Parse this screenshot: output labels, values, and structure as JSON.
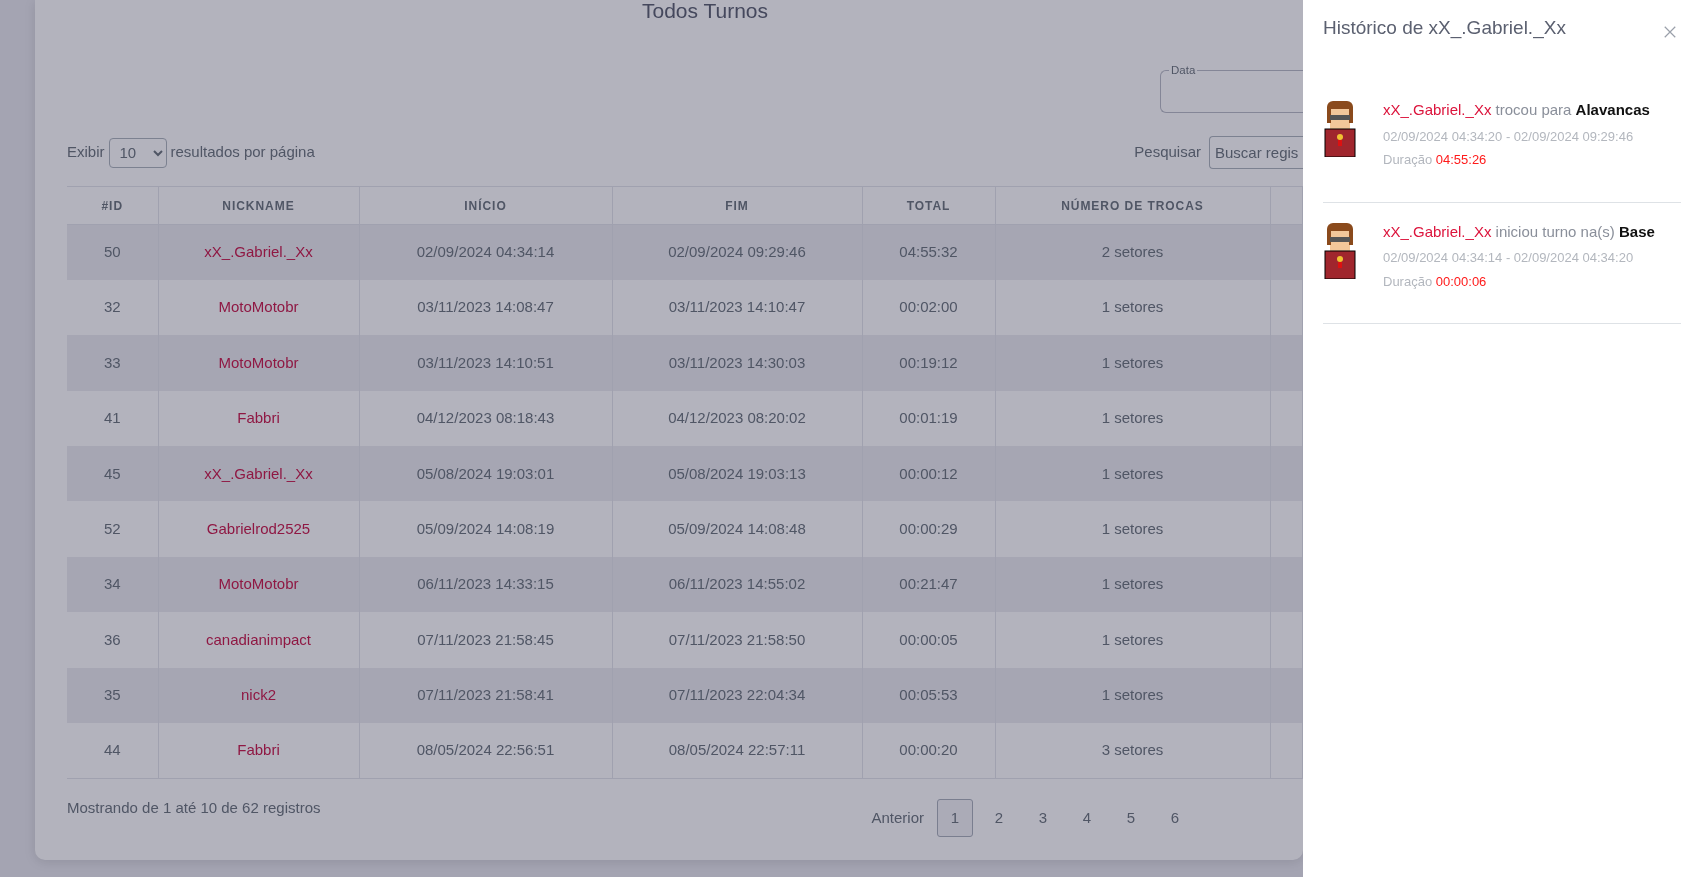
{
  "page": {
    "title": "Todos Turnos"
  },
  "date_filter": {
    "label": "Data"
  },
  "length": {
    "prefix": "Exibir",
    "value": "10",
    "suffix": "resultados por página"
  },
  "search": {
    "label": "Pesquisar",
    "placeholder": "Buscar regis"
  },
  "table": {
    "columns": [
      "#ID",
      "NICKNAME",
      "INÍCIO",
      "FIM",
      "TOTAL",
      "NÚMERO DE TROCAS"
    ],
    "rows": [
      {
        "id": "50",
        "nickname": "xX_.Gabriel._Xx",
        "start": "02/09/2024 04:34:14",
        "end": "02/09/2024 09:29:46",
        "total": "04:55:32",
        "trades": "2 setores"
      },
      {
        "id": "32",
        "nickname": "MotoMotobr",
        "start": "03/11/2023 14:08:47",
        "end": "03/11/2023 14:10:47",
        "total": "00:02:00",
        "trades": "1 setores"
      },
      {
        "id": "33",
        "nickname": "MotoMotobr",
        "start": "03/11/2023 14:10:51",
        "end": "03/11/2023 14:30:03",
        "total": "00:19:12",
        "trades": "1 setores"
      },
      {
        "id": "41",
        "nickname": "Fabbri",
        "start": "04/12/2023 08:18:43",
        "end": "04/12/2023 08:20:02",
        "total": "00:01:19",
        "trades": "1 setores"
      },
      {
        "id": "45",
        "nickname": "xX_.Gabriel._Xx",
        "start": "05/08/2024 19:03:01",
        "end": "05/08/2024 19:03:13",
        "total": "00:00:12",
        "trades": "1 setores"
      },
      {
        "id": "52",
        "nickname": "Gabrielrod2525",
        "start": "05/09/2024 14:08:19",
        "end": "05/09/2024 14:08:48",
        "total": "00:00:29",
        "trades": "1 setores"
      },
      {
        "id": "34",
        "nickname": "MotoMotobr",
        "start": "06/11/2023 14:33:15",
        "end": "06/11/2023 14:55:02",
        "total": "00:21:47",
        "trades": "1 setores"
      },
      {
        "id": "36",
        "nickname": "canadianimpact",
        "start": "07/11/2023 21:58:45",
        "end": "07/11/2023 21:58:50",
        "total": "00:00:05",
        "trades": "1 setores"
      },
      {
        "id": "35",
        "nickname": "nick2",
        "start": "07/11/2023 21:58:41",
        "end": "07/11/2023 22:04:34",
        "total": "00:05:53",
        "trades": "1 setores"
      },
      {
        "id": "44",
        "nickname": "Fabbri",
        "start": "08/05/2024 22:56:51",
        "end": "08/05/2024 22:57:11",
        "total": "00:00:20",
        "trades": "3 setores"
      }
    ]
  },
  "footer": {
    "info": "Mostrando de 1 até 10 de 62 registros"
  },
  "pagination": [
    {
      "label": "Anterior",
      "selected": false
    },
    {
      "label": "1",
      "selected": true
    },
    {
      "label": "2",
      "selected": false
    },
    {
      "label": "3",
      "selected": false
    },
    {
      "label": "4",
      "selected": false
    },
    {
      "label": "5",
      "selected": false
    },
    {
      "label": "6",
      "selected": false
    }
  ],
  "offcanvas": {
    "title": "Histórico de xX_.Gabriel._Xx",
    "entries": [
      {
        "user": "xX_.Gabriel._Xx",
        "action": "trocou para",
        "target": "Alavancas",
        "period": "02/09/2024 04:34:20 - 02/09/2024 09:29:46",
        "duration_label": "Duração",
        "duration": "04:55:26"
      },
      {
        "user": "xX_.Gabriel._Xx",
        "action": "iniciou turno na(s)",
        "target": "Base",
        "period": "02/09/2024 04:34:14 - 02/09/2024 04:34:20",
        "duration_label": "Duração",
        "duration": "00:00:06"
      }
    ]
  }
}
